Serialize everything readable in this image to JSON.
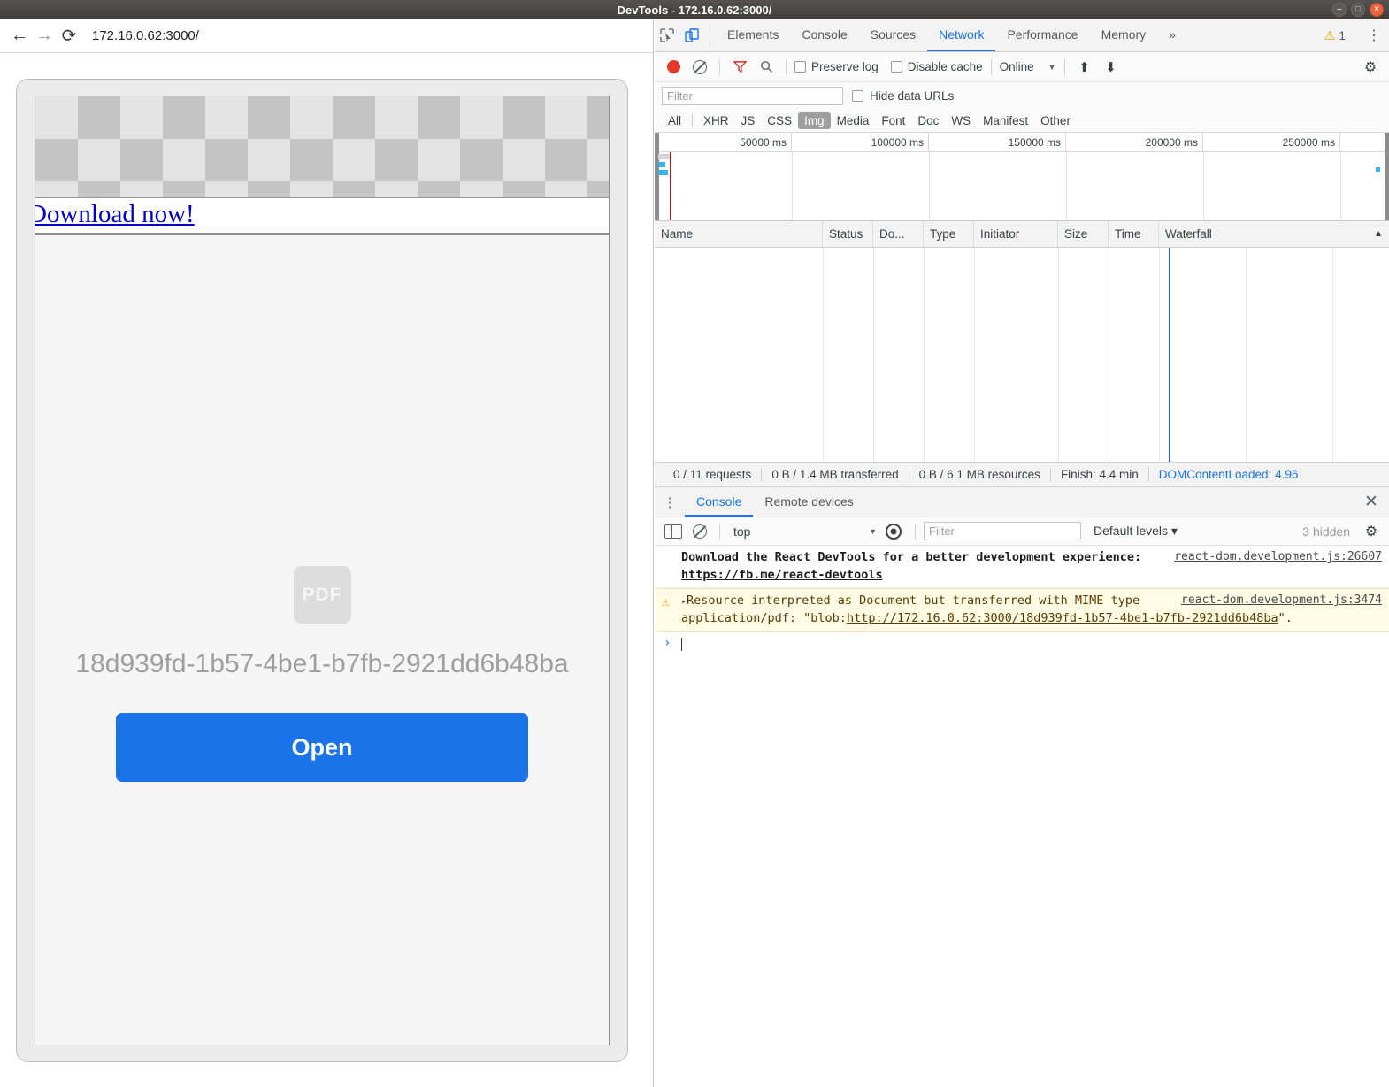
{
  "window": {
    "title": "DevTools - 172.16.0.62:3000/",
    "controls": {
      "minimize": "–",
      "maximize": "□",
      "close": "×"
    }
  },
  "browser": {
    "back_icon": "←",
    "forward_icon": "→",
    "reload_icon": "⟳",
    "url": "172.16.0.62:3000/",
    "page": {
      "download_link": "Download now!",
      "pdf_badge": "PDF",
      "file_name": "18d939fd-1b57-4be1-b7fb-2921dd6b48ba",
      "open_button": "Open",
      "accent": "#1a73e8"
    }
  },
  "devtools": {
    "tabs": [
      {
        "label": "Elements",
        "active": false
      },
      {
        "label": "Console",
        "active": false
      },
      {
        "label": "Sources",
        "active": false
      },
      {
        "label": "Network",
        "active": true
      },
      {
        "label": "Performance",
        "active": false
      },
      {
        "label": "Memory",
        "active": false
      }
    ],
    "more_tabs_icon": "»",
    "warning_count": "1",
    "warning_icon": "⚠",
    "kebab_icon": "⋮",
    "network": {
      "toolbar": {
        "record_title": "Record",
        "clear_title": "Clear",
        "filter_icon_title": "Filter",
        "search_icon": "⚲",
        "preserve_log": "Preserve log",
        "disable_cache": "Disable cache",
        "throttle": "Online",
        "caret": "▼",
        "import_icon": "⬆",
        "export_icon": "⬇",
        "settings_icon": "⚙"
      },
      "filter_placeholder": "Filter",
      "hide_data_urls": "Hide data URLs",
      "types": [
        "All",
        "XHR",
        "JS",
        "CSS",
        "Img",
        "Media",
        "Font",
        "Doc",
        "WS",
        "Manifest",
        "Other"
      ],
      "selected_type": "Img",
      "overview_ticks": [
        "50000 ms",
        "100000 ms",
        "150000 ms",
        "200000 ms",
        "250000 ms"
      ],
      "columns": [
        "Name",
        "Status",
        "Do...",
        "Type",
        "Initiator",
        "Size",
        "Time",
        "Waterfall"
      ],
      "sort_indicator": "▲",
      "status": {
        "requests": "0 / 11 requests",
        "transferred": "0 B / 1.4 MB transferred",
        "resources": "0 B / 6.1 MB resources",
        "finish": "Finish: 4.4 min",
        "dcl": "DOMContentLoaded: 4.96"
      }
    },
    "drawer": {
      "kebab_icon": "⋮",
      "tabs": [
        {
          "label": "Console",
          "active": true
        },
        {
          "label": "Remote devices",
          "active": false
        }
      ],
      "close_icon": "✕",
      "toolbar": {
        "sidebar_title": "Show console sidebar",
        "clear_title": "Clear console",
        "context": "top",
        "caret": "▼",
        "eye_title": "Create live expression",
        "filter_placeholder": "Filter",
        "levels": "Default levels ▾",
        "hidden": "3 hidden",
        "settings_icon": "⚙"
      },
      "messages": [
        {
          "kind": "info",
          "source": "react-dom.development.js:26607",
          "text": "Download the React DevTools for a better development experience: ",
          "link": "https://fb.me/react-devtools"
        },
        {
          "kind": "warning",
          "icon": "⚠",
          "expander": "▸",
          "source": "react-dom.development.js:3474",
          "text_a": "Resource interpreted as Document but transferred with MIME type application/pdf: \"blob:",
          "link": "http://172.16.0.62:3000/18d939fd-1b57-4be1-b7fb-2921dd6b48ba",
          "text_b": "\"."
        }
      ],
      "prompt_chevron": "›"
    }
  }
}
